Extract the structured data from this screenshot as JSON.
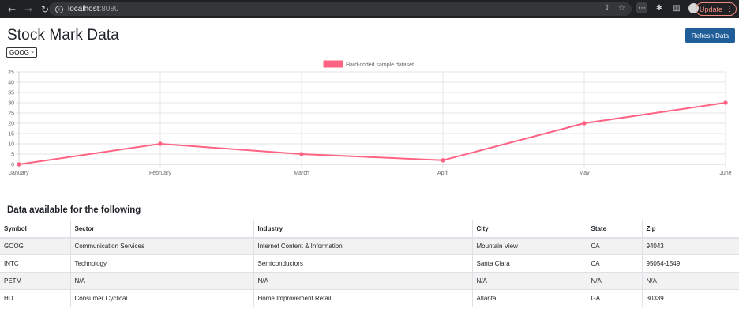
{
  "browser": {
    "url_host": "localhost",
    "url_port": ":8080",
    "update_label": "Update"
  },
  "page": {
    "title": "Stock Mark Data",
    "refresh_label": "Refresh Data",
    "select_value": "GOOG",
    "table_heading": "Data available for the following"
  },
  "chart_data": {
    "type": "line",
    "categories": [
      "January",
      "February",
      "March",
      "April",
      "May",
      "June"
    ],
    "series": [
      {
        "name": "Hard-coded sample dataset",
        "values": [
          0,
          10,
          5,
          2,
          20,
          30
        ],
        "color": "#ff6384"
      }
    ],
    "ylim": [
      0,
      45
    ],
    "yticks": [
      0,
      5,
      10,
      15,
      20,
      25,
      30,
      35,
      40,
      45
    ],
    "grid": true,
    "legend": "top-center"
  },
  "table": {
    "headers": [
      "Symbol",
      "Sector",
      "Industry",
      "City",
      "State",
      "Zip"
    ],
    "rows": [
      [
        "GOOG",
        "Communication Services",
        "Internet Content & Information",
        "Mountain View",
        "CA",
        "94043"
      ],
      [
        "INTC",
        "Technology",
        "Semiconductors",
        "Santa Clara",
        "CA",
        "95054-1549"
      ],
      [
        "PETM",
        "N/A",
        "N/A",
        "N/A",
        "N/A",
        "N/A"
      ],
      [
        "HD",
        "Consumer Cyclical",
        "Home Improvement Retail",
        "Atlanta",
        "GA",
        "30339"
      ]
    ]
  }
}
